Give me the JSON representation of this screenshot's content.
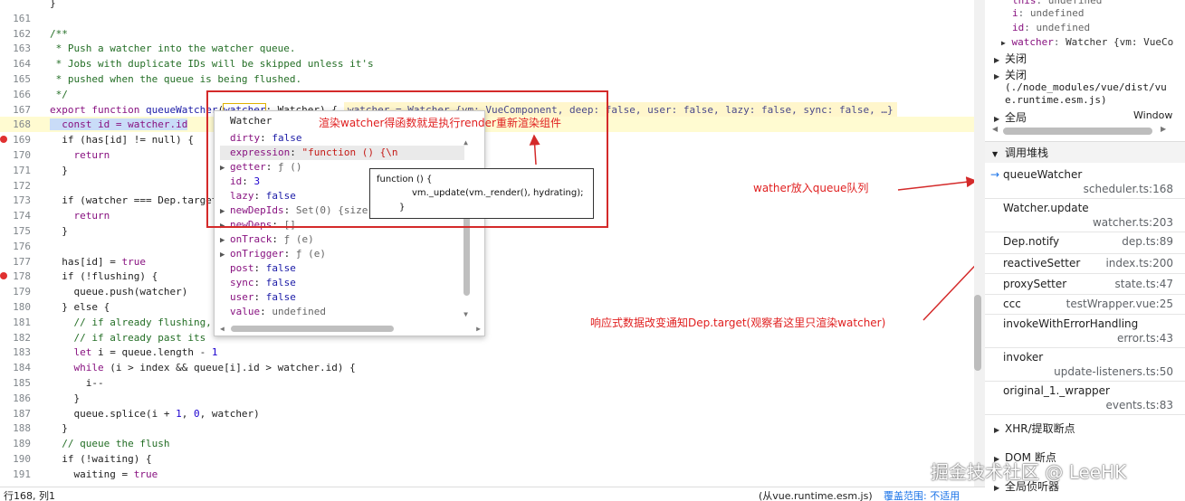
{
  "editor": {
    "lines": [
      {
        "n": "",
        "tokens": [
          {
            "c": "t-pl",
            "t": "}"
          }
        ]
      },
      {
        "n": "161",
        "tokens": []
      },
      {
        "n": "162",
        "tokens": [
          {
            "c": "t-cm",
            "t": "/**"
          }
        ]
      },
      {
        "n": "163",
        "tokens": [
          {
            "c": "t-cm",
            "t": " * Push a watcher into the watcher queue."
          }
        ]
      },
      {
        "n": "164",
        "tokens": [
          {
            "c": "t-cm",
            "t": " * Jobs with duplicate IDs will be skipped unless it's"
          }
        ]
      },
      {
        "n": "165",
        "tokens": [
          {
            "c": "t-cm",
            "t": " * pushed when the queue is being flushed."
          }
        ]
      },
      {
        "n": "166",
        "tokens": [
          {
            "c": "t-cm",
            "t": " */"
          }
        ]
      },
      {
        "n": "167",
        "tokens": [
          {
            "c": "t-kw",
            "t": "export function "
          },
          {
            "c": "t-fn",
            "t": "queueWatcher"
          },
          {
            "c": "t-pl",
            "t": "("
          },
          {
            "c": "t-fn t-box",
            "t": "watcher"
          },
          {
            "c": "t-pl",
            "t": ": Watcher) {"
          }
        ],
        "inline": "watcher = Watcher {vm: VueComponent, deep: false, user: false, lazy: false, sync: false, …}"
      },
      {
        "n": "168",
        "tokens": [
          {
            "c": "t-hl t-kw",
            "t": "  const id = watcher.id"
          }
        ],
        "paused": true
      },
      {
        "n": "169",
        "tokens": [
          {
            "c": "t-pl",
            "t": "  if (has[id] != null) {"
          }
        ],
        "bp": true
      },
      {
        "n": "170",
        "tokens": [
          {
            "c": "t-kw",
            "t": "    return"
          }
        ]
      },
      {
        "n": "171",
        "tokens": [
          {
            "c": "t-pl",
            "t": "  }"
          }
        ]
      },
      {
        "n": "172",
        "tokens": []
      },
      {
        "n": "173",
        "tokens": [
          {
            "c": "t-pl",
            "t": "  if (watcher === Dep.target"
          }
        ]
      },
      {
        "n": "174",
        "tokens": [
          {
            "c": "t-kw",
            "t": "    return"
          }
        ]
      },
      {
        "n": "175",
        "tokens": [
          {
            "c": "t-pl",
            "t": "  }"
          }
        ]
      },
      {
        "n": "176",
        "tokens": []
      },
      {
        "n": "177",
        "tokens": [
          {
            "c": "t-pl",
            "t": "  has[id] = "
          },
          {
            "c": "t-kw",
            "t": "true"
          }
        ]
      },
      {
        "n": "178",
        "tokens": [
          {
            "c": "t-pl",
            "t": "  if (!flushing) {"
          }
        ],
        "bp": true
      },
      {
        "n": "179",
        "tokens": [
          {
            "c": "t-pl",
            "t": "    queue.push(watcher)"
          }
        ]
      },
      {
        "n": "180",
        "tokens": [
          {
            "c": "t-pl",
            "t": "  } else {"
          }
        ]
      },
      {
        "n": "181",
        "tokens": [
          {
            "c": "t-cm",
            "t": "    // if already flushing,"
          }
        ]
      },
      {
        "n": "182",
        "tokens": [
          {
            "c": "t-cm",
            "t": "    // if already past its"
          }
        ]
      },
      {
        "n": "183",
        "tokens": [
          {
            "c": "t-kw",
            "t": "    let "
          },
          {
            "c": "t-pl",
            "t": "i = queue.length - "
          },
          {
            "c": "t-num",
            "t": "1"
          }
        ]
      },
      {
        "n": "184",
        "tokens": [
          {
            "c": "t-kw",
            "t": "    while "
          },
          {
            "c": "t-pl",
            "t": "(i > index && queue[i].id > watcher.id) {"
          }
        ]
      },
      {
        "n": "185",
        "tokens": [
          {
            "c": "t-pl",
            "t": "      i--"
          }
        ]
      },
      {
        "n": "186",
        "tokens": [
          {
            "c": "t-pl",
            "t": "    }"
          }
        ]
      },
      {
        "n": "187",
        "tokens": [
          {
            "c": "t-pl",
            "t": "    queue.splice(i + "
          },
          {
            "c": "t-num",
            "t": "1"
          },
          {
            "c": "t-pl",
            "t": ", "
          },
          {
            "c": "t-num",
            "t": "0"
          },
          {
            "c": "t-pl",
            "t": ", watcher)"
          }
        ]
      },
      {
        "n": "188",
        "tokens": [
          {
            "c": "t-pl",
            "t": "  }"
          }
        ]
      },
      {
        "n": "189",
        "tokens": [
          {
            "c": "t-cm",
            "t": "  // queue the flush"
          }
        ]
      },
      {
        "n": "190",
        "tokens": [
          {
            "c": "t-pl",
            "t": "  if (!waiting) {"
          }
        ]
      },
      {
        "n": "191",
        "tokens": [
          {
            "c": "t-pl",
            "t": "    waiting = "
          },
          {
            "c": "t-kw",
            "t": "true"
          }
        ]
      }
    ]
  },
  "popover": {
    "title": "Watcher",
    "rows": [
      {
        "tri": "",
        "key": "dirty",
        "val": "false",
        "vc": "pv-b"
      },
      {
        "tri": "",
        "key": "expression",
        "val": "\"function () {\\n",
        "vc": "pv-s",
        "sel": true
      },
      {
        "tri": "▶",
        "key": "getter",
        "val": "ƒ ()",
        "vc": "pv-g"
      },
      {
        "tri": "",
        "key": "id",
        "val": "3",
        "vc": "pv-n"
      },
      {
        "tri": "",
        "key": "lazy",
        "val": "false",
        "vc": "pv-b"
      },
      {
        "tri": "▶",
        "key": "newDepIds",
        "val": "Set(0) {size",
        "vc": "pv-g"
      },
      {
        "tri": "▶",
        "key": "newDeps",
        "val": "[]",
        "vc": "pv-g"
      },
      {
        "tri": "▶",
        "key": "onTrack",
        "val": "ƒ (e)",
        "vc": "pv-g"
      },
      {
        "tri": "▶",
        "key": "onTrigger",
        "val": "ƒ (e)",
        "vc": "pv-g"
      },
      {
        "tri": "",
        "key": "post",
        "val": "false",
        "vc": "pv-b"
      },
      {
        "tri": "",
        "key": "sync",
        "val": "false",
        "vc": "pv-b"
      },
      {
        "tri": "",
        "key": "user",
        "val": "false",
        "vc": "pv-b"
      },
      {
        "tri": "",
        "key": "value",
        "val": "undefined",
        "vc": "pv-g"
      }
    ]
  },
  "fn_tip": {
    "line1": "function () {",
    "line2": "vm._update(vm._render(), hydrating);",
    "line3": "}"
  },
  "annotations": {
    "render_note": "渲染watcher得函数就是执行render重新渲染组件",
    "queue_note": "wather放入queue队列",
    "dep_note": "响应式数据改变通知Dep.target(观察者这里只渲染watcher)"
  },
  "scope": {
    "rows": [
      {
        "key": "this",
        "val": "undefined"
      },
      {
        "key": "i",
        "val": "undefined"
      },
      {
        "key": "id",
        "val": "undefined"
      }
    ],
    "watcher_row": {
      "key": "watcher",
      "val": "Watcher {vm: VueCo"
    },
    "closure1": "关闭",
    "closure2": "关闭",
    "closure2_path1": "(./node_modules/vue/dist/vu",
    "closure2_path2": "e.runtime.esm.js)",
    "global": "全局",
    "global_val": "Window"
  },
  "callstack": {
    "header": "调用堆栈",
    "frames": [
      {
        "name": "queueWatcher",
        "loc": "scheduler.ts:168",
        "current": true
      },
      {
        "name": "Watcher.update",
        "loc": "watcher.ts:203"
      },
      {
        "name": "Dep.notify",
        "loc": "dep.ts:89"
      },
      {
        "name": "reactiveSetter",
        "loc": "index.ts:200"
      },
      {
        "name": "proxySetter",
        "loc": "state.ts:47"
      },
      {
        "name": "ccc",
        "loc": "testWrapper.vue:25"
      },
      {
        "name": "invokeWithErrorHandling",
        "loc": "error.ts:43"
      },
      {
        "name": "invoker",
        "loc": "update-listeners.ts:50"
      },
      {
        "name": "original_1._wrapper",
        "loc": "events.ts:83"
      }
    ]
  },
  "sections": {
    "xhr": "XHR/提取断点",
    "dom": "DOM 断点",
    "global_listeners": "全局侦听器"
  },
  "status": {
    "position": "行168, 列1",
    "source": "(从vue.runtime.esm.js)",
    "coverage": "覆盖范围: 不适用"
  },
  "watermark": "掘金技术社区 @ LeeHK",
  "colors": {
    "annotation": "#d42a2a",
    "paused_line": "#fffbd1",
    "accent": "#1a73e8"
  }
}
